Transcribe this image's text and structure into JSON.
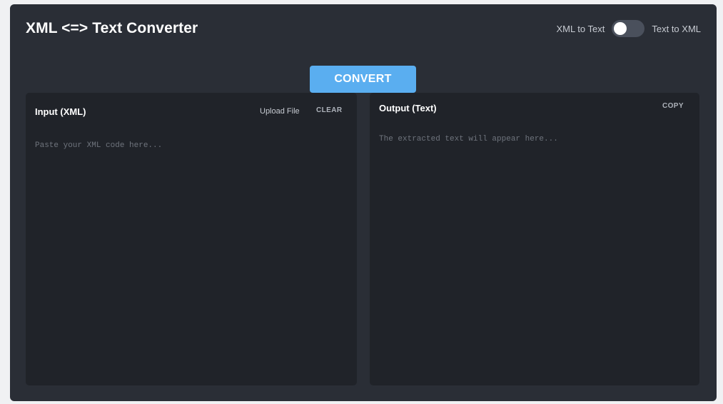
{
  "header": {
    "title": "XML <=> Text Converter"
  },
  "mode_toggle": {
    "left_label": "XML to Text",
    "right_label": "Text to XML",
    "state": "XML to Text"
  },
  "convert_button": {
    "label": "CONVERT",
    "color": "#5aaef0"
  },
  "input_panel": {
    "title": "Input (XML)",
    "upload_label": "Upload File",
    "clear_label": "CLEAR",
    "value": "",
    "placeholder": "Paste your XML code here..."
  },
  "output_panel": {
    "title": "Output (Text)",
    "copy_label": "COPY",
    "value": "",
    "placeholder": "The extracted text will appear here..."
  }
}
